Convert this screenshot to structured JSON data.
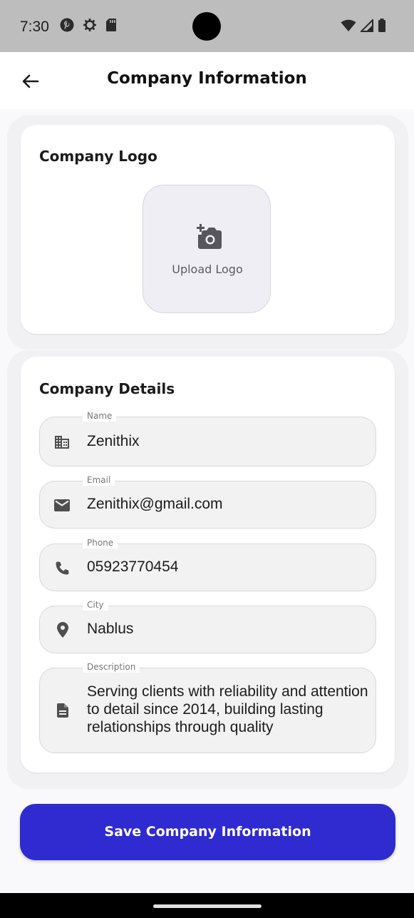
{
  "status_bar": {
    "time": "7:30",
    "left_icons": [
      "pinterest-icon",
      "settings-icon",
      "sd-card-icon"
    ],
    "right_icons": [
      "wifi-icon",
      "signal-icon",
      "battery-icon"
    ]
  },
  "app_bar": {
    "title": "Company Information",
    "back_icon": "arrow-back-icon"
  },
  "logo_section": {
    "title": "Company Logo",
    "upload_label": "Upload Logo",
    "upload_icon": "add-a-photo-icon"
  },
  "details_section": {
    "title": "Company Details",
    "fields": [
      {
        "label": "Name",
        "value": "Zenithix",
        "icon": "business-icon"
      },
      {
        "label": "Email",
        "value": "Zenithix@gmail.com",
        "icon": "email-icon"
      },
      {
        "label": "Phone",
        "value": "05923770454",
        "icon": "phone-icon"
      },
      {
        "label": "City",
        "value": "Nablus",
        "icon": "location-pin-icon"
      },
      {
        "label": "Description",
        "value": "Serving clients with reliability and attention to detail since 2014, building lasting relationships through quality",
        "icon": "description-icon"
      }
    ]
  },
  "save_button": {
    "label": "Save Company Information"
  },
  "colors": {
    "primary": "#2f2bd1",
    "status_bar": "#bdbdbd",
    "background": "#f9f9fb"
  }
}
